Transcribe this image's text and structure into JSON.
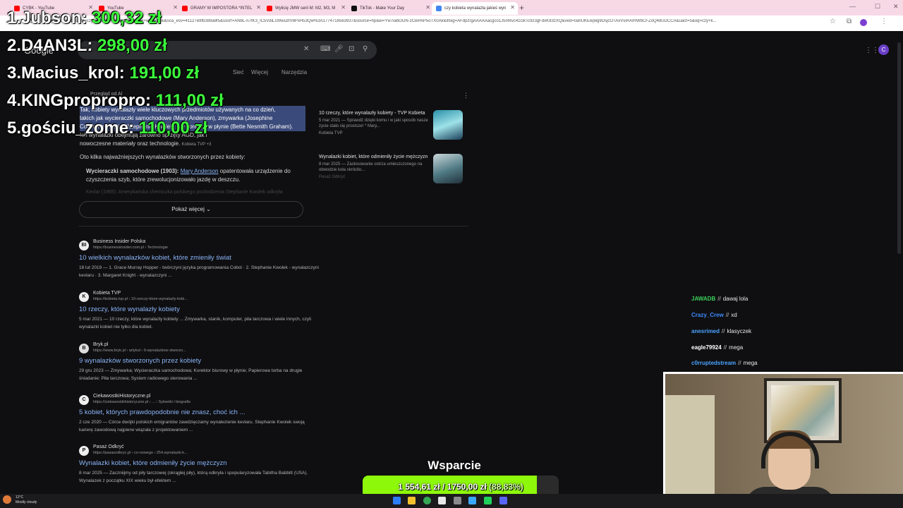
{
  "browser": {
    "tabs": [
      {
        "label": "CYBK - YouTube",
        "color": "#ff0000"
      },
      {
        "label": "YouTube",
        "color": "#ff0000"
      },
      {
        "label": "GRAMY W IMPOSTORA *INTEL",
        "color": "#ff0000"
      },
      {
        "label": "Wylicię JMW serii M: M2, M3, M",
        "color": "#ff0000"
      },
      {
        "label": "TikTok - Make Your Day",
        "color": "#111111"
      },
      {
        "label": "czy kobieta wynalazła jakieś wyn",
        "color": "#4285f4"
      }
    ],
    "new_tab": "+",
    "url": "google.com/search?q=czy+kobieta+wynalazła+jakieś+wynalazki&sca_esv=41127e9fb389a8f5&sxsrf=ANbL-n7tK3_lC5VdiL1WwuztV8PxH53Qw%3A1774718563937&source=hp&ei=Yw7iabOGN-zCwPAP5oTX0Ak&iflsig=AFdpzrgAAAAAacgco1J5nhtvc41GkTc9z3gFdxK83zXQ&ved=0ahUKEwjwg9DsjcOTAxVsiRAIHWbCFZoQ4dUDCCA&uact=5&oq=czy+k..."
  },
  "google": {
    "logo": "Google",
    "tabs": [
      "Sieć",
      "Więcej",
      "Narzędzia"
    ],
    "ai_label": "Przegląd od AI",
    "ai_lines": [
      "Tak, kobiety wynalazły wiele kluczowych przedmiotów używanych na co dzień,",
      "takich jak wycieraczki samochodowe (Mary Anderson), zmywarka (Josephine",
      "Cochrane), kevlar (Stephanie Kwolek) czy korektor w płynie (Bette Nesmith Graham).",
      "Ich wynalazki obejmują zarówno sprzęty AGD, jak i",
      "nowoczesne materiały oraz technologie."
    ],
    "ai_source": "Kobieta TVP +3",
    "ai_intro": "Oto kilka najważniejszych wynalazków stworzonych przez kobiety:",
    "ai_bullet_bold": "Wycieraczki samochodowe (1903):",
    "ai_bullet_link": "Mary Anderson",
    "ai_bullet_rest": "opatentowała urządzenie do",
    "ai_bullet_line2": "czyszczenia szyb, które zrewolucjonizowało jazdę w deszczu.",
    "ai_faded": "Kevlar (1965): Amerykańska chemiczka polskiego pochodzenia Stephanie Kwolek odkryła",
    "show_more": "Pokaż więcej",
    "side_cards": [
      {
        "title": "10 rzeczy, które wynalazły kobiety - TVP Kobieta",
        "snippet": "5 mar 2021 — Sprawdź dzięki komu i w jaki sposób nasze życie stało się prostsze! * Mary...",
        "source": "Kobieta TVP"
      },
      {
        "title": "Wynalazki kobiet, które odmieniły życie mężczyzn",
        "snippet": "8 mar 2025 — Zastosowanie ostrza umieszczonego na obwodzie koła skróciło...",
        "source": "Pasaż Odkryć"
      }
    ],
    "results": [
      {
        "icon": "BI",
        "site": "Business Insider Polska",
        "crumb": "https://businessinsider.com.pl › Technologie",
        "title": "10 wielkich wynalazków kobiet, które zmieniły świat",
        "snippet": "18 lut 2019 — 1. Grace Murray Hopper - twórczyni języka programowania Cobol · 2. Stephanie Kwolek - wynalazczyni kevlaru · 3. Margaret Knight - wynalazczyni ..."
      },
      {
        "icon": "K",
        "site": "Kobieta TVP",
        "crumb": "https://kobieta.tvp.pl › 10-rzeczy-ktore-wynalazly-kobi...",
        "title": "10 rzeczy, które wynalazły kobiety",
        "snippet": "5 mar 2021 — 10 rzeczy, które wynalazły kobiety ... Zmywarka, stanik, komputer, piła tarczowa i wiele innych, czyli wynalazki kobiet nie tylko dla kobiet."
      },
      {
        "icon": "B",
        "site": "Bryk.pl",
        "crumb": "https://www.bryk.pl › artykul › 9-wynalazkow-stworzo...",
        "title": "9 wynalazków stworzonych przez kobiety",
        "snippet": "29 gru 2023 — Zmywarka; Wycieraczka samochodowa; Korektor biurowy w płynie; Papierowa torba na drugie śniadanie; Piła tarczowa; System radiowego sterowania ..."
      },
      {
        "icon": "C",
        "site": "CiekawostkiHistoryczne.pl",
        "crumb": "https://ciekawostkihistoryczne.pl › ... › Sylwetki i biografie",
        "title": "5 kobiet, których prawdopodobnie nie znasz, choć ich ...",
        "snippet": "2 cze 2020 — Córce dwójki polskich emigrantów zawdzięczamy wynalezienie kevlaru. Stephanie Kwolek swoją karierę zawodową najpierw wiązała z projektowaniem ..."
      },
      {
        "icon": "P",
        "site": "Pasaż Odkryć",
        "crumb": "https://pasazodkryc.pl › co-nowego › 254,wynalazki-k...",
        "title": "Wynalazki kobiet, które odmieniły życie mężczyzn",
        "snippet": "8 mar 2025 — Zaczniijmy od piły tarczowej (okrągłej piły), którą odkryła i spopularyzowała Tabitha Babbitt (USA). Wynalazek z początku XIX wieku był efektem ..."
      }
    ]
  },
  "leaderboard": [
    {
      "rank": "1.",
      "name": "Jubson:",
      "amount": "300,32 zł"
    },
    {
      "rank": "2.",
      "name": "D4AN3L:",
      "amount": "298,00 zł"
    },
    {
      "rank": "3.",
      "name": "Macius_krol:",
      "amount": "191,00 zł"
    },
    {
      "rank": "4.",
      "name": "KINGpropropro:",
      "amount": "111,00 zł"
    },
    {
      "rank": "5.",
      "name": "gościu_zome:",
      "amount": "110,00 zł"
    }
  ],
  "chat": [
    {
      "user": "JAWADB",
      "color": "#3cd05a",
      "msg": "dawaj lola"
    },
    {
      "user": "Crazy_Crew",
      "color": "#3c8cff",
      "msg": "xd"
    },
    {
      "user": "anesrimed",
      "color": "#4aa3ff",
      "msg": "klasyczek"
    },
    {
      "user": "eagle79924",
      "color": "#ffffff",
      "msg": "mega"
    },
    {
      "user": "c0rruptedstream",
      "color": "#4aa3ff",
      "msg": "mega"
    }
  ],
  "goal": {
    "title": "Wsparcie",
    "current": "1 554,61 zł",
    "sep": "/",
    "target": "1750,00 zł",
    "percent": "(88,83%)",
    "fraction": 0.8883,
    "fill_color": "#8ef80b"
  },
  "taskbar": {
    "weather_temp": "12°C",
    "weather_desc": "Mostly cloudy"
  }
}
